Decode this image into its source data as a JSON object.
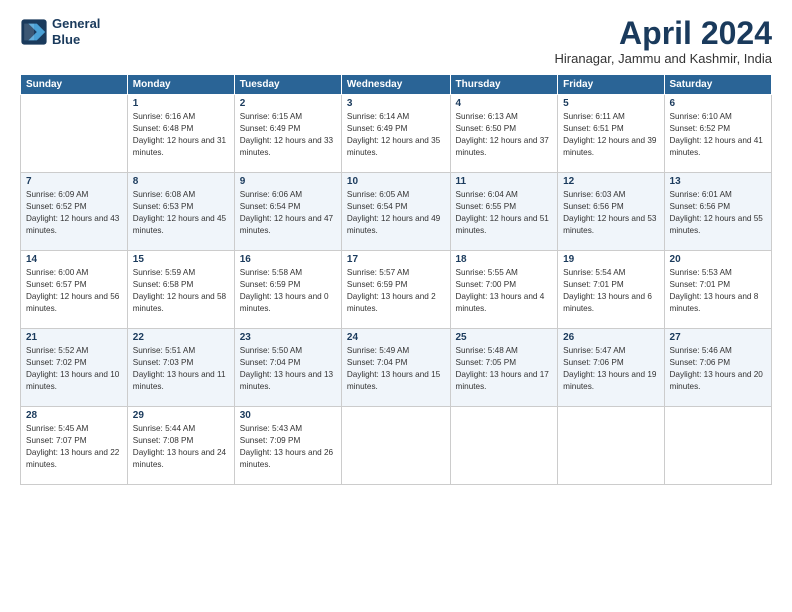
{
  "header": {
    "logo_line1": "General",
    "logo_line2": "Blue",
    "title": "April 2024",
    "location": "Hiranagar, Jammu and Kashmir, India"
  },
  "days_of_week": [
    "Sunday",
    "Monday",
    "Tuesday",
    "Wednesday",
    "Thursday",
    "Friday",
    "Saturday"
  ],
  "weeks": [
    [
      {
        "day": "",
        "sunrise": "",
        "sunset": "",
        "daylight": ""
      },
      {
        "day": "1",
        "sunrise": "Sunrise: 6:16 AM",
        "sunset": "Sunset: 6:48 PM",
        "daylight": "Daylight: 12 hours and 31 minutes."
      },
      {
        "day": "2",
        "sunrise": "Sunrise: 6:15 AM",
        "sunset": "Sunset: 6:49 PM",
        "daylight": "Daylight: 12 hours and 33 minutes."
      },
      {
        "day": "3",
        "sunrise": "Sunrise: 6:14 AM",
        "sunset": "Sunset: 6:49 PM",
        "daylight": "Daylight: 12 hours and 35 minutes."
      },
      {
        "day": "4",
        "sunrise": "Sunrise: 6:13 AM",
        "sunset": "Sunset: 6:50 PM",
        "daylight": "Daylight: 12 hours and 37 minutes."
      },
      {
        "day": "5",
        "sunrise": "Sunrise: 6:11 AM",
        "sunset": "Sunset: 6:51 PM",
        "daylight": "Daylight: 12 hours and 39 minutes."
      },
      {
        "day": "6",
        "sunrise": "Sunrise: 6:10 AM",
        "sunset": "Sunset: 6:52 PM",
        "daylight": "Daylight: 12 hours and 41 minutes."
      }
    ],
    [
      {
        "day": "7",
        "sunrise": "Sunrise: 6:09 AM",
        "sunset": "Sunset: 6:52 PM",
        "daylight": "Daylight: 12 hours and 43 minutes."
      },
      {
        "day": "8",
        "sunrise": "Sunrise: 6:08 AM",
        "sunset": "Sunset: 6:53 PM",
        "daylight": "Daylight: 12 hours and 45 minutes."
      },
      {
        "day": "9",
        "sunrise": "Sunrise: 6:06 AM",
        "sunset": "Sunset: 6:54 PM",
        "daylight": "Daylight: 12 hours and 47 minutes."
      },
      {
        "day": "10",
        "sunrise": "Sunrise: 6:05 AM",
        "sunset": "Sunset: 6:54 PM",
        "daylight": "Daylight: 12 hours and 49 minutes."
      },
      {
        "day": "11",
        "sunrise": "Sunrise: 6:04 AM",
        "sunset": "Sunset: 6:55 PM",
        "daylight": "Daylight: 12 hours and 51 minutes."
      },
      {
        "day": "12",
        "sunrise": "Sunrise: 6:03 AM",
        "sunset": "Sunset: 6:56 PM",
        "daylight": "Daylight: 12 hours and 53 minutes."
      },
      {
        "day": "13",
        "sunrise": "Sunrise: 6:01 AM",
        "sunset": "Sunset: 6:56 PM",
        "daylight": "Daylight: 12 hours and 55 minutes."
      }
    ],
    [
      {
        "day": "14",
        "sunrise": "Sunrise: 6:00 AM",
        "sunset": "Sunset: 6:57 PM",
        "daylight": "Daylight: 12 hours and 56 minutes."
      },
      {
        "day": "15",
        "sunrise": "Sunrise: 5:59 AM",
        "sunset": "Sunset: 6:58 PM",
        "daylight": "Daylight: 12 hours and 58 minutes."
      },
      {
        "day": "16",
        "sunrise": "Sunrise: 5:58 AM",
        "sunset": "Sunset: 6:59 PM",
        "daylight": "Daylight: 13 hours and 0 minutes."
      },
      {
        "day": "17",
        "sunrise": "Sunrise: 5:57 AM",
        "sunset": "Sunset: 6:59 PM",
        "daylight": "Daylight: 13 hours and 2 minutes."
      },
      {
        "day": "18",
        "sunrise": "Sunrise: 5:55 AM",
        "sunset": "Sunset: 7:00 PM",
        "daylight": "Daylight: 13 hours and 4 minutes."
      },
      {
        "day": "19",
        "sunrise": "Sunrise: 5:54 AM",
        "sunset": "Sunset: 7:01 PM",
        "daylight": "Daylight: 13 hours and 6 minutes."
      },
      {
        "day": "20",
        "sunrise": "Sunrise: 5:53 AM",
        "sunset": "Sunset: 7:01 PM",
        "daylight": "Daylight: 13 hours and 8 minutes."
      }
    ],
    [
      {
        "day": "21",
        "sunrise": "Sunrise: 5:52 AM",
        "sunset": "Sunset: 7:02 PM",
        "daylight": "Daylight: 13 hours and 10 minutes."
      },
      {
        "day": "22",
        "sunrise": "Sunrise: 5:51 AM",
        "sunset": "Sunset: 7:03 PM",
        "daylight": "Daylight: 13 hours and 11 minutes."
      },
      {
        "day": "23",
        "sunrise": "Sunrise: 5:50 AM",
        "sunset": "Sunset: 7:04 PM",
        "daylight": "Daylight: 13 hours and 13 minutes."
      },
      {
        "day": "24",
        "sunrise": "Sunrise: 5:49 AM",
        "sunset": "Sunset: 7:04 PM",
        "daylight": "Daylight: 13 hours and 15 minutes."
      },
      {
        "day": "25",
        "sunrise": "Sunrise: 5:48 AM",
        "sunset": "Sunset: 7:05 PM",
        "daylight": "Daylight: 13 hours and 17 minutes."
      },
      {
        "day": "26",
        "sunrise": "Sunrise: 5:47 AM",
        "sunset": "Sunset: 7:06 PM",
        "daylight": "Daylight: 13 hours and 19 minutes."
      },
      {
        "day": "27",
        "sunrise": "Sunrise: 5:46 AM",
        "sunset": "Sunset: 7:06 PM",
        "daylight": "Daylight: 13 hours and 20 minutes."
      }
    ],
    [
      {
        "day": "28",
        "sunrise": "Sunrise: 5:45 AM",
        "sunset": "Sunset: 7:07 PM",
        "daylight": "Daylight: 13 hours and 22 minutes."
      },
      {
        "day": "29",
        "sunrise": "Sunrise: 5:44 AM",
        "sunset": "Sunset: 7:08 PM",
        "daylight": "Daylight: 13 hours and 24 minutes."
      },
      {
        "day": "30",
        "sunrise": "Sunrise: 5:43 AM",
        "sunset": "Sunset: 7:09 PM",
        "daylight": "Daylight: 13 hours and 26 minutes."
      },
      {
        "day": "",
        "sunrise": "",
        "sunset": "",
        "daylight": ""
      },
      {
        "day": "",
        "sunrise": "",
        "sunset": "",
        "daylight": ""
      },
      {
        "day": "",
        "sunrise": "",
        "sunset": "",
        "daylight": ""
      },
      {
        "day": "",
        "sunrise": "",
        "sunset": "",
        "daylight": ""
      }
    ]
  ]
}
